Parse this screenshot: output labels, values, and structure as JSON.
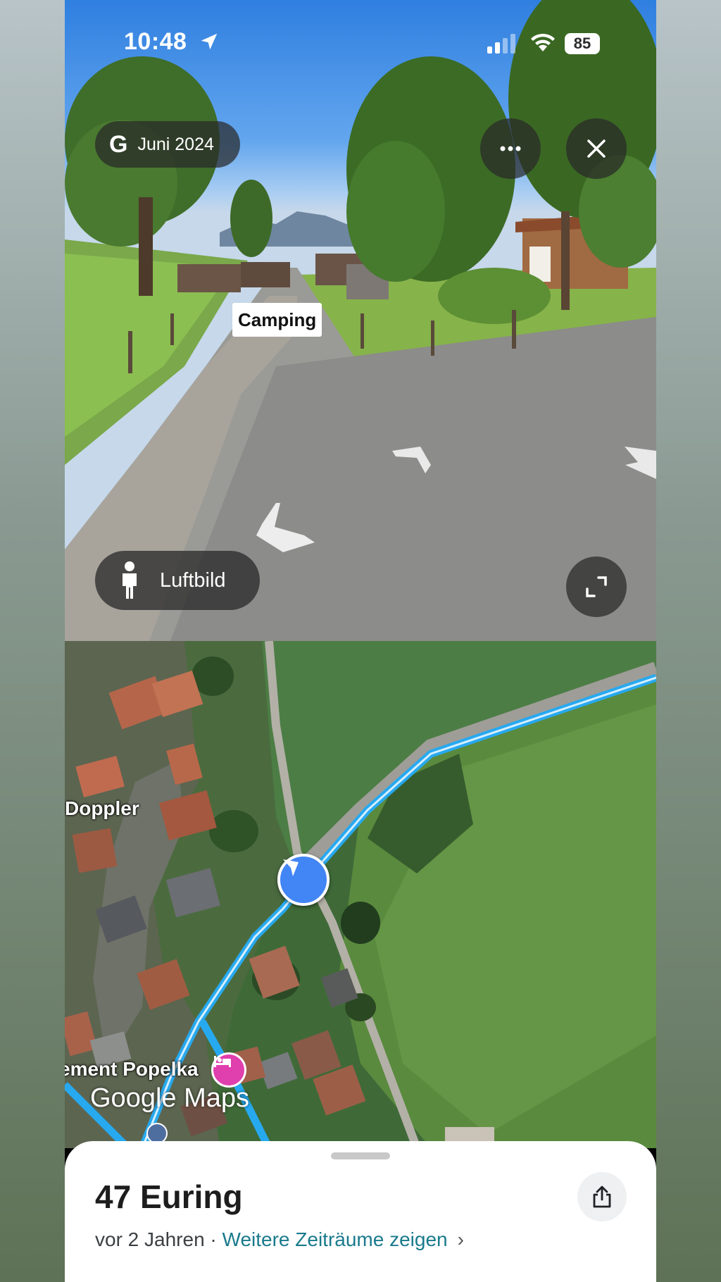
{
  "status_bar": {
    "time": "10:48",
    "battery": "85"
  },
  "street_view": {
    "date_chip": {
      "logo": "G",
      "label": "Juni 2024"
    },
    "more_icon": "more-horizontal-icon",
    "close_icon": "close-icon",
    "place_label": "Camping",
    "aerial_button": {
      "icon": "pegman-icon",
      "label": "Luftbild"
    },
    "expand_icon": "expand-icon"
  },
  "map": {
    "labels": {
      "doppler": "Doppler",
      "popelka": "ement Popelka"
    },
    "logo": "Google Maps",
    "route_color": "#27a9f0",
    "marker_color": "#4285f4",
    "hotel_pin_color": "#e03fae"
  },
  "sheet": {
    "title": "47 Euring",
    "age": "vor 2 Jahren",
    "separator": " · ",
    "more_link": "Weitere Zeiträume zeigen",
    "share_icon": "share-icon"
  }
}
